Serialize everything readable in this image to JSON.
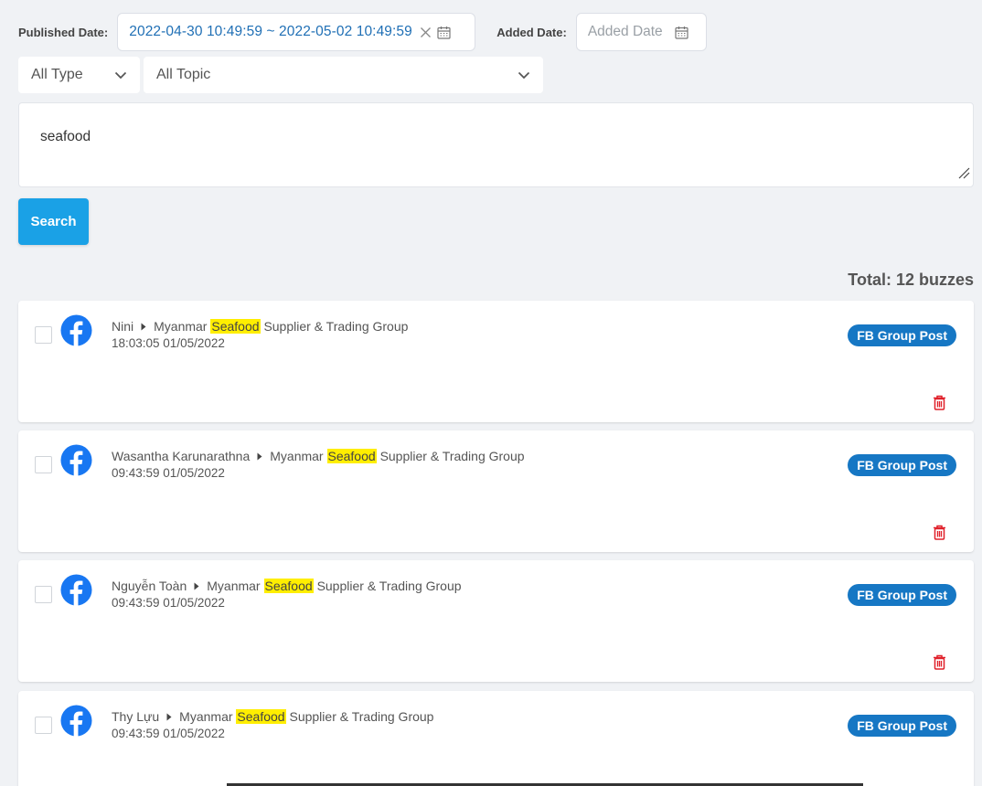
{
  "filters": {
    "published_label": "Published Date:",
    "published_value": "2022-04-30 10:49:59 ~ 2022-05-02 10:49:59",
    "added_label": "Added Date:",
    "added_placeholder": "Added Date",
    "type_select": "All Type",
    "topic_select": "All Topic"
  },
  "query": {
    "text": "seafood"
  },
  "search_button": "Search",
  "total_text": "Total: 12 buzzes",
  "colors": {
    "accent": "#1aa1e6",
    "badge": "#1677c4",
    "highlight": "#ffee00",
    "facebook": "#1877f2",
    "trash": "#e0202a"
  },
  "posts": [
    {
      "author": "Nini",
      "group_pre": "Myanmar",
      "group_hl": "Seafood",
      "group_post": "Supplier & Trading Group",
      "time": "18:03:05 01/05/2022",
      "badge": "FB Group Post",
      "source_icon": "facebook-icon"
    },
    {
      "author": "Wasantha Karunarathna",
      "group_pre": "Myanmar",
      "group_hl": "Seafood",
      "group_post": "Supplier & Trading Group",
      "time": "09:43:59 01/05/2022",
      "badge": "FB Group Post",
      "source_icon": "facebook-icon"
    },
    {
      "author": "Nguyễn Toàn",
      "group_pre": "Myanmar",
      "group_hl": "Seafood",
      "group_post": "Supplier & Trading Group",
      "time": "09:43:59 01/05/2022",
      "badge": "FB Group Post",
      "source_icon": "facebook-icon"
    },
    {
      "author": "Thy Lựu",
      "group_pre": "Myanmar",
      "group_hl": "Seafood",
      "group_post": "Supplier & Trading Group",
      "time": "09:43:59 01/05/2022",
      "badge": "FB Group Post",
      "source_icon": "facebook-icon"
    }
  ]
}
